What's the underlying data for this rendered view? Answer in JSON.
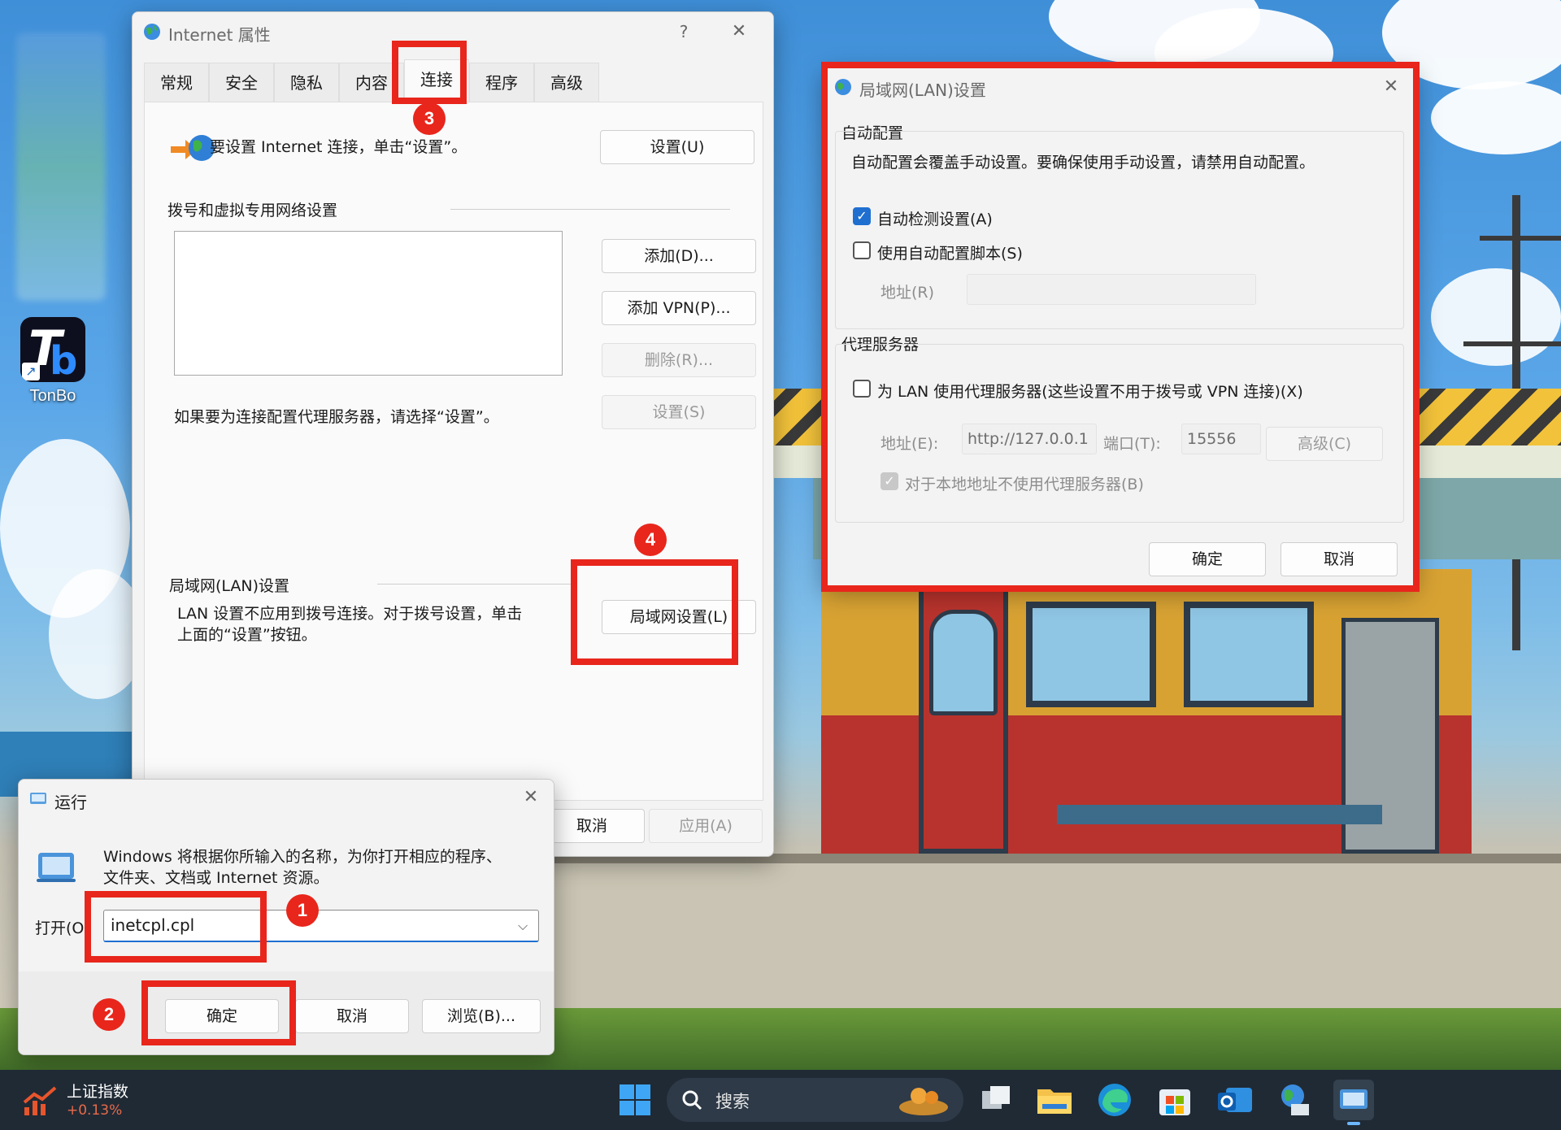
{
  "desktop": {
    "icon_label": "TonBo"
  },
  "inet_dialog": {
    "title": "Internet 属性",
    "help": "?",
    "close": "✕",
    "tabs": [
      "常规",
      "安全",
      "隐私",
      "内容",
      "连接",
      "程序",
      "高级"
    ],
    "active_tab": "连接",
    "setup_text": "要设置 Internet 连接，单击“设置”。",
    "setup_button": "设置(U)",
    "dialup_heading": "拨号和虚拟专用网络设置",
    "add_button": "添加(D)...",
    "add_vpn_button": "添加 VPN(P)...",
    "remove_button": "删除(R)...",
    "proxy_hint": "如果要为连接配置代理服务器，请选择“设置”。",
    "settings_button": "设置(S)",
    "lan_heading": "局域网(LAN)设置",
    "lan_text_1": "LAN 设置不应用到拨号连接。对于拨号设置，单击",
    "lan_text_2": "上面的“设置”按钮。",
    "lan_button": "局域网设置(L)",
    "cancel_button": "取消",
    "apply_button": "应用(A)"
  },
  "lan_dialog": {
    "title": "局域网(LAN)设置",
    "close": "✕",
    "auto_heading": "自动配置",
    "auto_desc": "自动配置会覆盖手动设置。要确保使用手动设置，请禁用自动配置。",
    "auto_detect_label": "自动检测设置(A)",
    "auto_detect_checked": true,
    "auto_script_label": "使用自动配置脚本(S)",
    "auto_script_checked": false,
    "address_label": "地址(R)",
    "proxy_heading": "代理服务器",
    "use_proxy_label": "为 LAN 使用代理服务器(这些设置不用于拨号或 VPN 连接)(X)",
    "use_proxy_checked": false,
    "proxy_address_label": "地址(E):",
    "proxy_address_value": "http://127.0.0.1",
    "port_label": "端口(T):",
    "port_value": "15556",
    "advanced_button": "高级(C)",
    "bypass_label": "对于本地地址不使用代理服务器(B)",
    "ok_button": "确定",
    "cancel_button": "取消"
  },
  "run_dialog": {
    "title": "运行",
    "close": "✕",
    "description_1": "Windows 将根据你所输入的名称，为你打开相应的程序、",
    "description_2": "文件夹、文档或 Internet 资源。",
    "open_label": "打开(O",
    "input_value": "inetcpl.cpl",
    "ok_button": "确定",
    "cancel_button": "取消",
    "browse_button": "浏览(B)..."
  },
  "annotations": {
    "step1": "1",
    "step2": "2",
    "step3": "3",
    "step4": "4",
    "highlight_color": "#e8261c"
  },
  "taskbar": {
    "widget_title": "上证指数",
    "widget_value": "+0.13%",
    "search_placeholder": "搜索"
  }
}
